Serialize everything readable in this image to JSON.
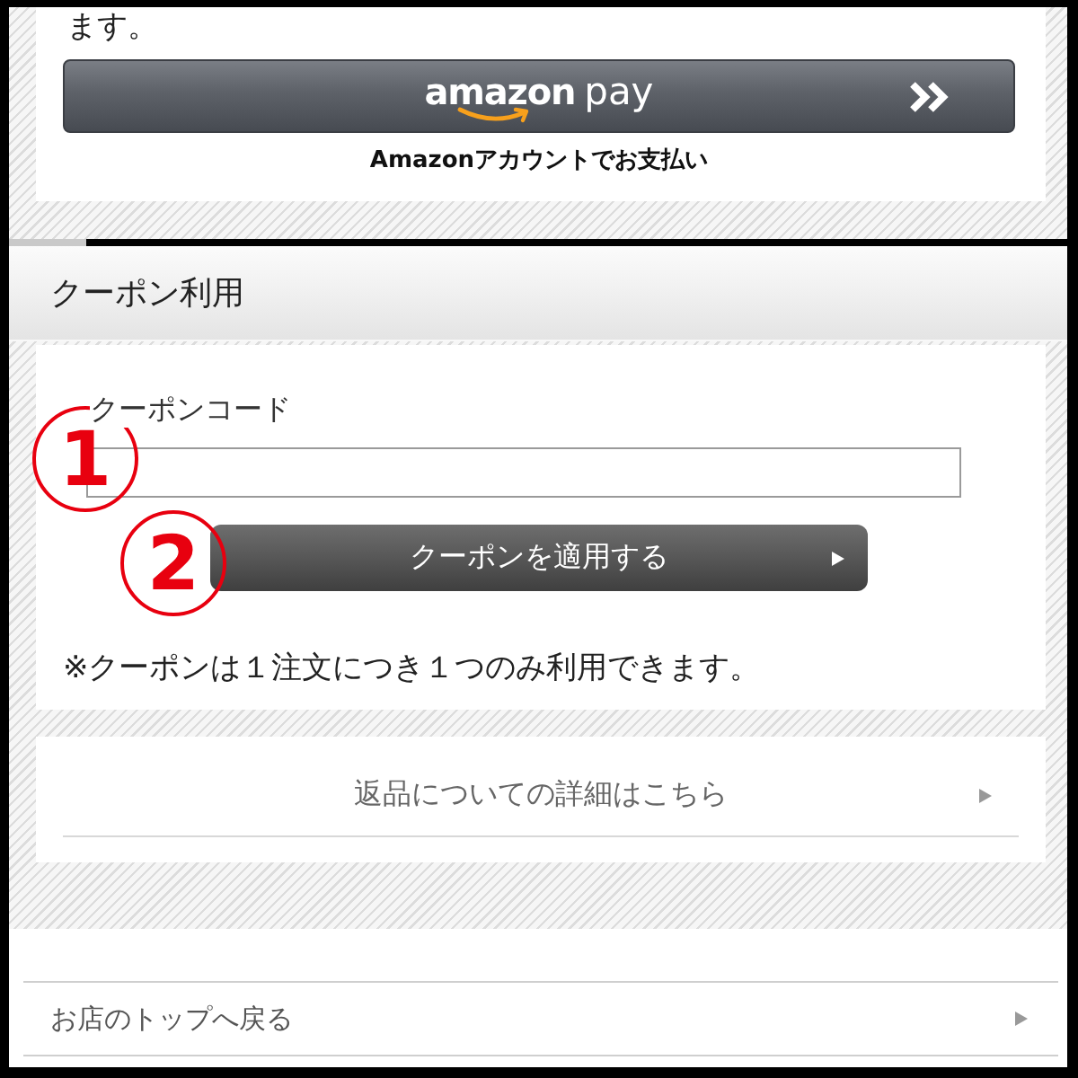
{
  "intro": {
    "text_tail": "ます。"
  },
  "amazon_pay": {
    "logo": {
      "wordmark": "amazon",
      "suffix": "pay"
    },
    "caption": "Amazonアカウントでお支払い"
  },
  "coupon": {
    "title": "クーポン利用",
    "code_label": "クーポンコード",
    "code_marker": "1",
    "apply_marker": "2",
    "apply_button": "クーポンを適用する",
    "note": "※クーポンは１注文につき１つのみ利用できます。"
  },
  "returns_link": {
    "label": "返品についての詳細はこちら"
  },
  "footer_links": [
    {
      "label": "お店のトップへ戻る"
    }
  ]
}
